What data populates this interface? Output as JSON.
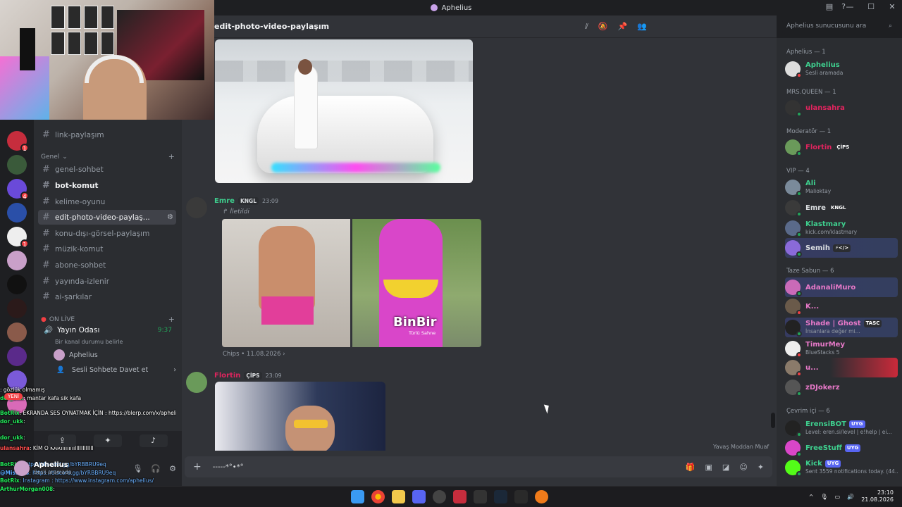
{
  "window": {
    "title": "Aphelius"
  },
  "header": {
    "channel_name": "edit-photo-video-paylaşım",
    "search_placeholder": "Aphelius sunucusunu ara"
  },
  "channels": {
    "link_channel": "link-paylaşım",
    "category_genel": "Genel",
    "items": [
      {
        "name": "genel-sohbet"
      },
      {
        "name": "bot-komut"
      },
      {
        "name": "kelime-oyunu"
      },
      {
        "name": "edit-photo-video-paylaş..."
      },
      {
        "name": "konu-dışı-görsel-paylaşım"
      },
      {
        "name": "müzik-komut"
      },
      {
        "name": "abone-sohbet"
      },
      {
        "name": "yayında-izlenir"
      },
      {
        "name": "ai-şarkılar"
      }
    ],
    "category_live": "ON LİVE",
    "voice_channel": "Yayın Odası",
    "voice_time": "9:37",
    "voice_status": "Bir kanal durumu belirle",
    "voice_user": "Aphelius",
    "voice_invite": "Sesli Sohbete Davet et"
  },
  "server_badges": [
    "1",
    "4",
    "1"
  ],
  "messages": [
    {
      "name": "Emre",
      "tag": "KNGL",
      "time": "23:09",
      "forwarded_label": "İletildi",
      "watermark": "BinBir",
      "watermark_sub": "Türlü Sahne",
      "source": "Chips • 11.08.2026"
    },
    {
      "name": "Flortin",
      "tag": "ÇİPS",
      "time": "23:09"
    }
  ],
  "composer": {
    "value": "-----*°•*°"
  },
  "slowmode": "Yavaş Moddan Muaf",
  "chatlog": {
    "new_badge": "YENİ",
    "lines": [
      {
        "user": "",
        "text": ": gözlük olmamış",
        "color": "r"
      },
      {
        "user": "dor_ukk",
        "text": ": mantar kafa sik kafa",
        "color": "g"
      },
      {
        "user": "BotRix",
        "text": ": EKRANDA SES OYNATMAK İÇİN : https://blerp.com/x/aphelius",
        "color": "g"
      },
      {
        "user": "dor_ukk",
        "text": ":",
        "color": "g"
      },
      {
        "user": "",
        "text": "",
        "color": "r"
      },
      {
        "user": "dor_ukk",
        "text": ":",
        "color": "g"
      },
      {
        "user": "ulansahra",
        "text": ": KİM O KARIIIIIIIIIIIIIIIIIIIII",
        "color": "r"
      },
      {
        "user": "BotRix",
        "text": ": https://discord.gg/bYRBBRU9eq",
        "color": "g"
      },
      {
        "user": "@MissXss",
        "text": ": https://discord.gg/bYRBBRU9eq",
        "color": "b"
      },
      {
        "user": "BotRix",
        "text": ": Instagram : https://www.instagram.com/aphelius/",
        "color": "g"
      },
      {
        "user": "ArthurMorgan008",
        "text": ":",
        "color": "g"
      }
    ]
  },
  "user_panel": {
    "name": "Aphelius",
    "status": "Sesli aramada",
    "sub": "Yayın Odası / Aphelius"
  },
  "members": {
    "groups": [
      {
        "label": "Aphelius — 1"
      },
      {
        "label": "MRS.QUEEN — 1"
      },
      {
        "label": "Moderatör — 1"
      },
      {
        "label": "VIP — 4"
      },
      {
        "label": "Taze Sabun — 6"
      },
      {
        "label": "Çevrim içi — 6"
      }
    ],
    "list": [
      {
        "name": "Aphelius",
        "sub": "Sesli aramada",
        "color": "#3ecf8e"
      },
      {
        "name": "ulansahra",
        "sub": "",
        "color": "#e0245e"
      },
      {
        "name": "Flortin",
        "sub": "",
        "color": "#e0245e",
        "tag": "ÇİPS"
      },
      {
        "name": "Ali",
        "sub": "Malioktay",
        "color": "#3ecf8e"
      },
      {
        "name": "Emre",
        "sub": "",
        "color": "#dbdee1",
        "tag": "KNGL"
      },
      {
        "name": "Klastmary",
        "sub": "kick.com/klastmary",
        "color": "#3ecf8e"
      },
      {
        "name": "Semih",
        "sub": "",
        "color": "#dbdee1",
        "tag": "⚡</>"
      },
      {
        "name": "AdanaliMuro",
        "sub": "",
        "color": "#e879c9"
      },
      {
        "name": "K...",
        "sub": "",
        "color": "#e879c9"
      },
      {
        "name": "Shade | Ghost",
        "sub": "İnsanlara değer mi...",
        "color": "#e879c9",
        "tag": "TASC"
      },
      {
        "name": "TimurMey",
        "sub": "BlueStacks 5",
        "color": "#e879c9"
      },
      {
        "name": "u...",
        "sub": "",
        "color": "#e879c9"
      },
      {
        "name": "zDJokerz",
        "sub": "",
        "color": "#e879c9"
      },
      {
        "name": "ErensiBOT",
        "sub": "Level: eren.si/level | e!help | ei...",
        "color": "#3ecf8e",
        "tag": "UYG"
      },
      {
        "name": "FreeStuff",
        "sub": "",
        "color": "#3ecf8e",
        "tag": "UYG"
      },
      {
        "name": "Kick",
        "sub": "Sent 3559 notifications today. (44...",
        "color": "#3ecf8e",
        "tag": "UYG"
      }
    ]
  },
  "taskbar": {
    "time": "23:10",
    "date": "21.08.2026"
  }
}
